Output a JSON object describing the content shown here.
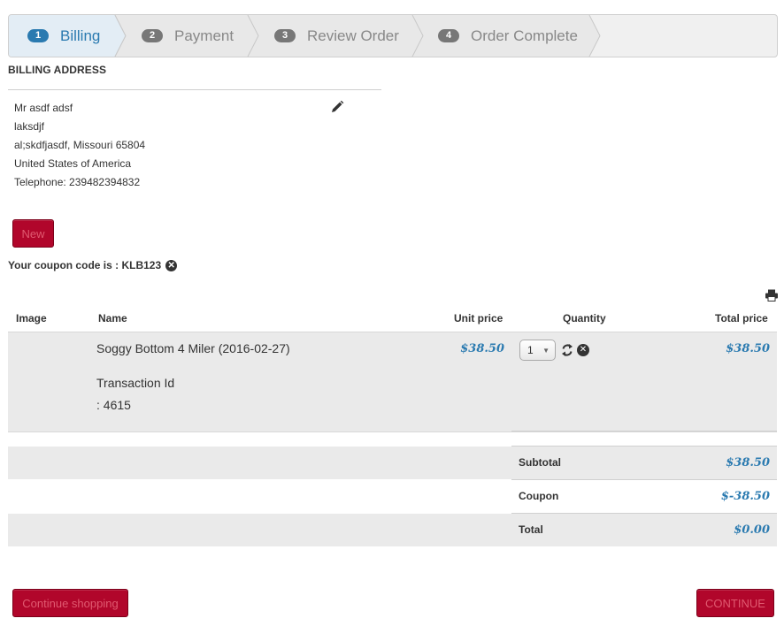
{
  "steps": [
    {
      "num": "1",
      "label": "Billing"
    },
    {
      "num": "2",
      "label": "Payment"
    },
    {
      "num": "3",
      "label": "Review Order"
    },
    {
      "num": "4",
      "label": "Order Complete"
    }
  ],
  "billing": {
    "title": "BILLING ADDRESS",
    "lines": [
      "Mr asdf adsf",
      "laksdjf",
      "al;skdfjasdf, Missouri 65804",
      "United States of America",
      "Telephone: 239482394832"
    ]
  },
  "buttons": {
    "new": "New",
    "continue_shopping": "Continue shopping",
    "continue": "CONTINUE"
  },
  "coupon": {
    "text": "Your coupon code is : KLB123"
  },
  "table": {
    "headers": {
      "image": "Image",
      "name": "Name",
      "unit_price": "Unit price",
      "quantity": "Quantity",
      "total_price": "Total price"
    },
    "item": {
      "name": "Soggy Bottom 4 Miler (2016-02-27)",
      "transaction_label": "Transaction Id",
      "transaction_value": ": 4615",
      "unit_price": "$38.50",
      "quantity": "1",
      "total_price": "$38.50"
    }
  },
  "summary": {
    "subtotal_label": "Subtotal",
    "subtotal": "$38.50",
    "coupon_label": "Coupon",
    "coupon": "$-38.50",
    "total_label": "Total",
    "total": "$0.00"
  },
  "colors": {
    "accent": "#2a7ab0",
    "button": "#b1062b"
  }
}
